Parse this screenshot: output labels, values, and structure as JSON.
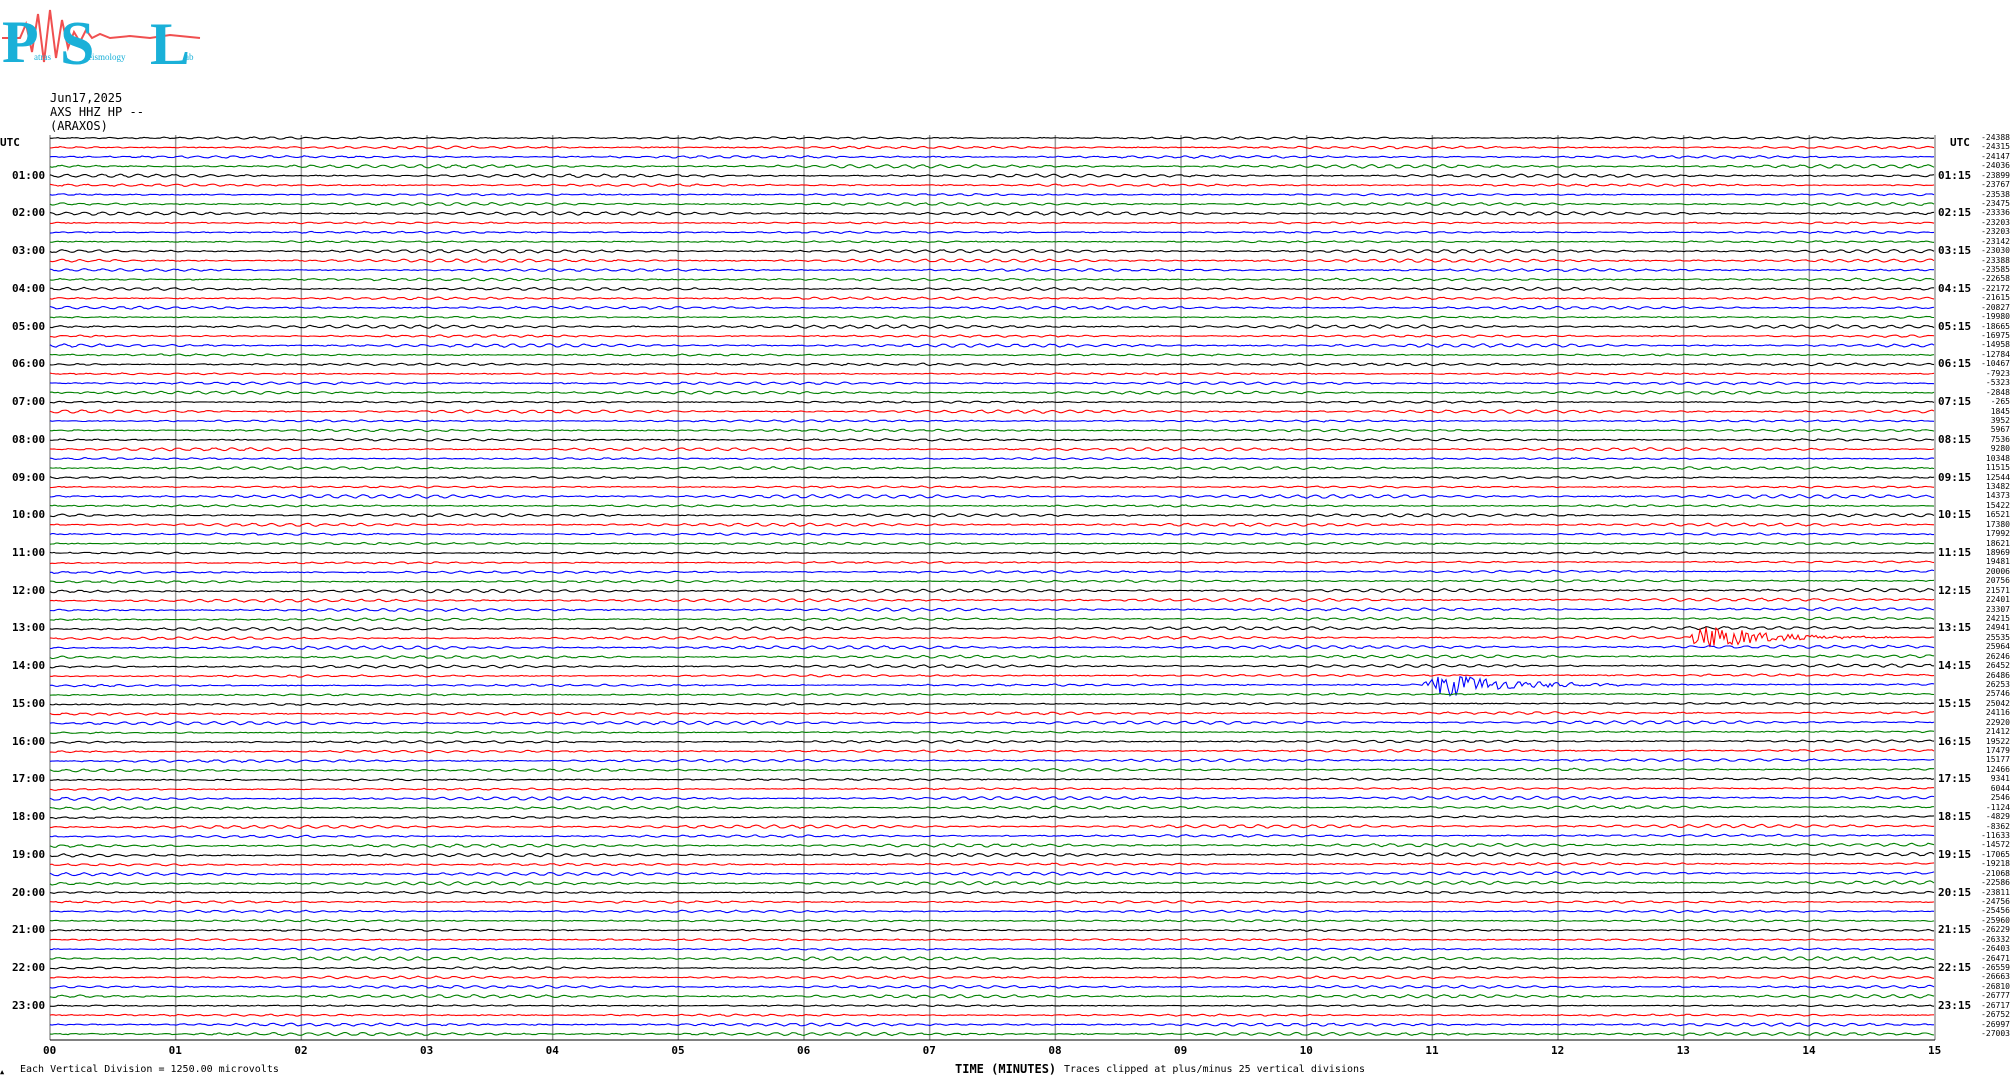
{
  "logo": {
    "letters": [
      "P",
      "S",
      "L"
    ],
    "subwords": [
      "atras",
      "eismology",
      "ab"
    ],
    "colors": {
      "letters": "#1ab0d8",
      "wave": "#f05050"
    }
  },
  "header": {
    "date": "Jun17,2025",
    "channel": "AXS HHZ HP --",
    "station": "(ARAXOS)"
  },
  "chart_data": {
    "type": "line",
    "title": "",
    "xlabel": "TIME (MINUTES)",
    "xlim": [
      0,
      15
    ],
    "x_ticks": [
      "00",
      "01",
      "02",
      "03",
      "04",
      "05",
      "06",
      "07",
      "08",
      "09",
      "10",
      "11",
      "12",
      "13",
      "14",
      "15"
    ],
    "left_axis_label": "UTC",
    "right_axis_label": "UTC",
    "left_hour_labels": [
      "01:00",
      "02:00",
      "03:00",
      "04:00",
      "05:00",
      "06:00",
      "07:00",
      "08:00",
      "09:00",
      "10:00",
      "11:00",
      "12:00",
      "13:00",
      "14:00",
      "15:00",
      "16:00",
      "17:00",
      "18:00",
      "19:00",
      "20:00",
      "21:00",
      "22:00",
      "23:00"
    ],
    "right_hour_labels": [
      "01:15",
      "02:15",
      "03:15",
      "04:15",
      "05:15",
      "06:15",
      "07:15",
      "08:15",
      "09:15",
      "10:15",
      "11:15",
      "12:15",
      "13:15",
      "14:15",
      "15:15",
      "16:15",
      "17:15",
      "18:15",
      "19:15",
      "20:15",
      "21:15",
      "22:15",
      "23:15"
    ],
    "trace_colors": [
      "#000000",
      "#ff0000",
      "#0000ff",
      "#008000"
    ],
    "trace_count": 96,
    "trace_offsets": [
      "-24388",
      "-24315",
      "-24147",
      "-24036",
      "-23899",
      "-23767",
      "-23538",
      "-23475",
      "-23336",
      "-23203",
      "-23203",
      "-23142",
      "-23030",
      "-23388",
      "-23585",
      "-22658",
      "-22172",
      "-21615",
      "-20827",
      "-19980",
      "-18665",
      "-16975",
      "-14958",
      "-12784",
      "-10467",
      "-7923",
      "-5323",
      "-2848",
      "-265",
      "1845",
      "3952",
      "5967",
      "7536",
      "9280",
      "10348",
      "11515",
      "12544",
      "13482",
      "14373",
      "15422",
      "16521",
      "17380",
      "17992",
      "18621",
      "18969",
      "19481",
      "20006",
      "20756",
      "21571",
      "22401",
      "23307",
      "24215",
      "24941",
      "25535",
      "25964",
      "26246",
      "26452",
      "26486",
      "26253",
      "25746",
      "25042",
      "24116",
      "22920",
      "21412",
      "19522",
      "17479",
      "15177",
      "12466",
      "9341",
      "6044",
      "2546",
      "-1124",
      "-4829",
      "-8362",
      "-11633",
      "-14572",
      "-17065",
      "-19218",
      "-21068",
      "-22586",
      "-23811",
      "-24756",
      "-25456",
      "-25960",
      "-26229",
      "-26332",
      "-26403",
      "-26471",
      "-26559",
      "-26663",
      "-26810",
      "-26777",
      "-26717",
      "-26752",
      "-26997",
      "-27003"
    ],
    "events": [
      {
        "trace": 53,
        "minute": 13.2,
        "label": "largest burst"
      },
      {
        "trace": 58,
        "minute": 11.1,
        "label": "blue burst"
      }
    ]
  },
  "footer": {
    "scale_note": "Each Vertical Division = 1250.00 microvolts",
    "clip_note": "Traces clipped at plus/minus 25 vertical divisions",
    "corner_mark": "▲"
  }
}
